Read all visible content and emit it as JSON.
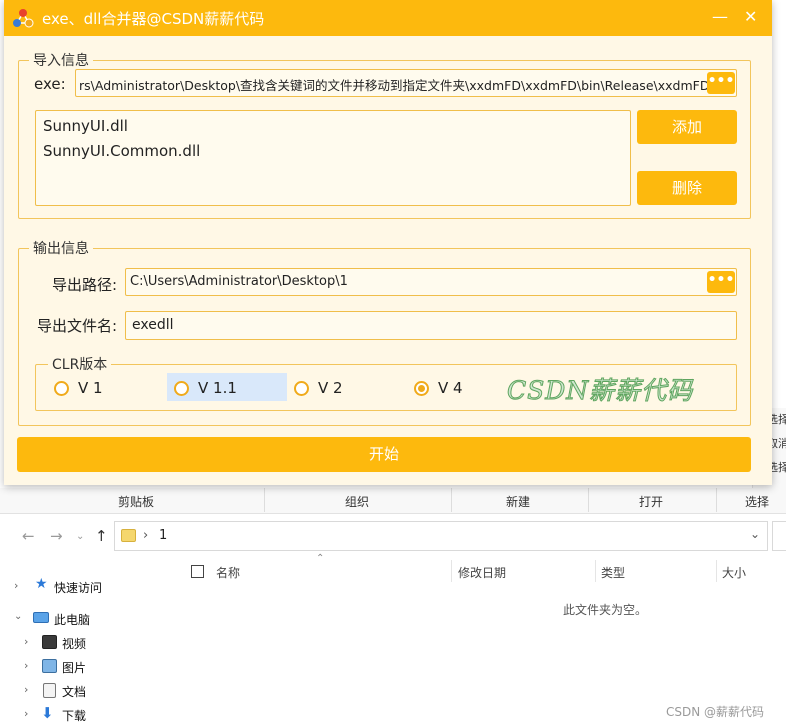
{
  "app": {
    "title": "exe、dll合并器@CSDN薪薪代码",
    "colors": {
      "accent": "#fdb90d",
      "border": "#f0be4a",
      "window_bg": "#fff8e6",
      "watermark": "#5fa55f"
    },
    "title_icons": {
      "logo": "network-logo-icon",
      "minimize": "minimize-icon",
      "close": "close-icon"
    },
    "import_group": {
      "legend": "导入信息",
      "exe_label": "exe:",
      "exe_path": "rs\\Administrator\\Desktop\\查找含关键词的文件并移动到指定文件夹\\xxdmFD\\xxdmFD\\bin\\Release\\xxdmFD.exe",
      "browse_icon": "•••",
      "dlls": [
        "SunnyUI.dll",
        "SunnyUI.Common.dll"
      ],
      "add_label": "添加",
      "delete_label": "删除"
    },
    "output_group": {
      "legend": "输出信息",
      "path_label": "导出路径:",
      "path_value": "C:\\Users\\Administrator\\Desktop\\1",
      "browse_icon": "•••",
      "filename_label": "导出文件名:",
      "filename_value": "exedll",
      "clr": {
        "legend": "CLR版本",
        "options": [
          "V 1",
          "V 1.1",
          "V 2",
          "V 4"
        ],
        "selected": "V 4",
        "highlighted": "V 1.1"
      },
      "watermark": "CSDN薪薪代码"
    },
    "start_label": "开始"
  },
  "explorer": {
    "ribbon_fragments": [
      "选择",
      "取消",
      "选择"
    ],
    "groups": [
      "剪贴板",
      "组织",
      "新建",
      "打开",
      "选择"
    ],
    "breadcrumb": "1",
    "breadcrumb_sep": "›",
    "nav_icons": {
      "back": "back-arrow-icon",
      "forward": "forward-arrow-icon",
      "history": "chevron-down-icon",
      "up": "up-arrow-icon"
    },
    "nav_items": [
      {
        "label": "快速访问",
        "icon": "star-icon"
      },
      {
        "label": "此电脑",
        "icon": "computer-icon"
      },
      {
        "label": "视频",
        "icon": "video-icon"
      },
      {
        "label": "图片",
        "icon": "picture-icon"
      },
      {
        "label": "文档",
        "icon": "document-icon"
      },
      {
        "label": "下载",
        "icon": "download-icon"
      }
    ],
    "columns": [
      "名称",
      "修改日期",
      "类型",
      "大小"
    ],
    "empty_text": "此文件夹为空。",
    "watermark": "CSDN @薪薪代码"
  }
}
